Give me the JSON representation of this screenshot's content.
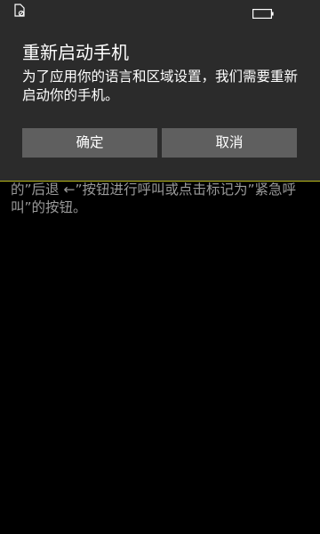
{
  "status_bar": {
    "left_icon": "sim-card-blocked-icon",
    "right_icon": "battery-icon"
  },
  "dialog": {
    "title": "重新启动手机",
    "message": "为了应用你的语言和区域设置，我们需要重新启动你的手机。",
    "confirm_label": "确定",
    "cancel_label": "取消",
    "accent_line_color": "#b9b91e"
  },
  "background": {
    "text": "的”后退 ←”按钮进行呼叫或点击标记为”紧急呼叫”的按钮。"
  }
}
